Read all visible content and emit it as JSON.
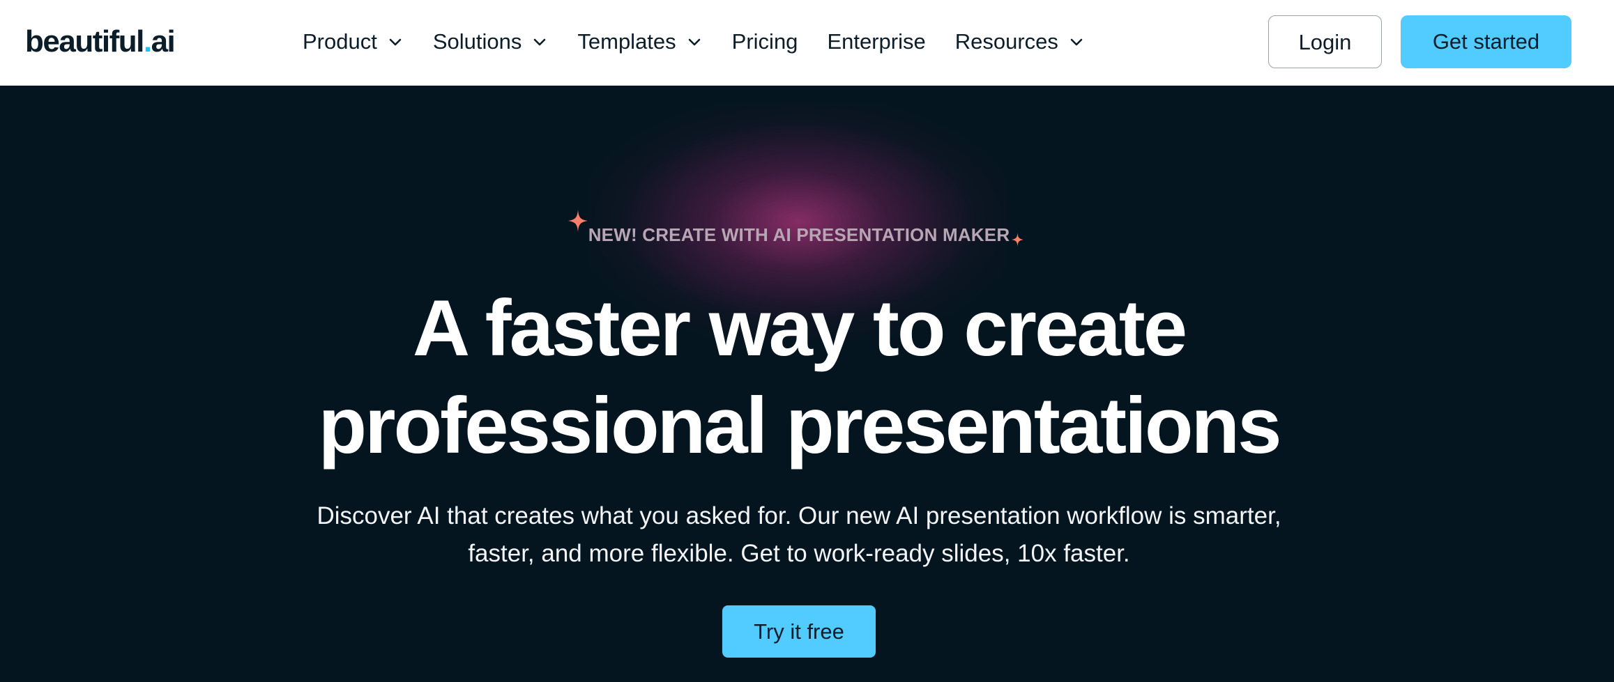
{
  "brand": {
    "logo_main": "beautiful",
    "logo_dot": ".",
    "logo_suffix": "ai",
    "accent_color": "#1ec0ff"
  },
  "nav": {
    "items": [
      {
        "label": "Product",
        "has_dropdown": true
      },
      {
        "label": "Solutions",
        "has_dropdown": true
      },
      {
        "label": "Templates",
        "has_dropdown": true
      },
      {
        "label": "Pricing",
        "has_dropdown": false
      },
      {
        "label": "Enterprise",
        "has_dropdown": false
      },
      {
        "label": "Resources",
        "has_dropdown": true
      }
    ],
    "dropdown_icon": "chevron-down-icon"
  },
  "header_actions": {
    "login_label": "Login",
    "get_started_label": "Get started",
    "cta_color": "#52cbff"
  },
  "hero": {
    "eyebrow": "NEW! CREATE WITH AI PRESENTATION MAKER",
    "sparkle_icon": "sparkle-icon",
    "sparkle_color": "#ff7f6b",
    "headline_line1": "A faster way to create",
    "headline_line2": "professional presentations",
    "subtext_line1": "Discover AI that creates what you asked for. Our new AI presentation workflow is smarter,",
    "subtext_line2": "faster, and more flexible. Get to work-ready slides, 10x faster.",
    "cta_label": "Try it free",
    "background_color": "#04151f",
    "glow_color": "#8c2d69"
  }
}
